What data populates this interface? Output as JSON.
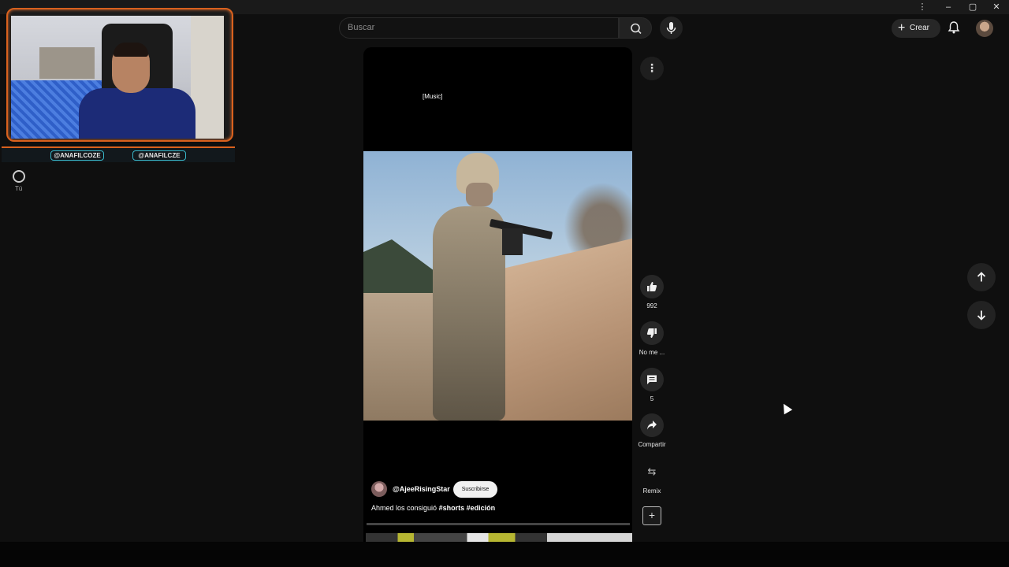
{
  "search": {
    "placeholder": "Buscar"
  },
  "header": {
    "create_label": "Crear"
  },
  "webcam": {
    "handle_left": "@ANAFILCOZE",
    "handle_right": "@ANAFILCZE"
  },
  "sidebar": {
    "shorts_label": "Tú"
  },
  "short": {
    "caption": "[Music]",
    "channel": "@AjeeRisingStar",
    "subscribe_label": "Suscribirse",
    "description": "Ahmed los consiguió",
    "hashtags": "#shorts #edición",
    "progress": 0.0
  },
  "actions": {
    "like_count": "992",
    "dislike_label": "No me ...",
    "comment_count": "5",
    "share_label": "Compartir",
    "remix_label": "Remix"
  },
  "icons": [
    "search-icon",
    "mic-icon",
    "plus-icon",
    "bell-icon",
    "thumb-up-icon",
    "thumb-down-icon",
    "comment-icon",
    "share-icon",
    "remix-icon",
    "arrow-up-icon",
    "arrow-down-icon",
    "more-vert-icon"
  ],
  "colors": {
    "accent": "#ff0033",
    "background": "#0f0f0f",
    "webcam_frame": "#d9611e",
    "webcam_handle_border": "#38b6c8"
  }
}
